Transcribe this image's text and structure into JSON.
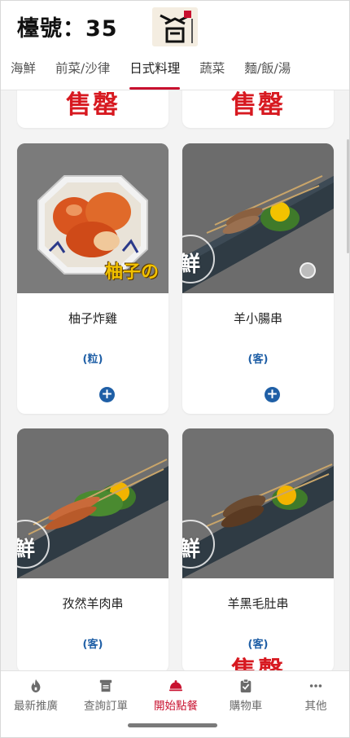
{
  "header": {
    "table_label": "檯號：35",
    "logo_icon": "restaurant-logo"
  },
  "tabs": [
    {
      "label": "海鮮",
      "active": false
    },
    {
      "label": "前菜/沙律",
      "active": false
    },
    {
      "label": "日式料理",
      "active": true
    },
    {
      "label": "蔬菜",
      "active": false
    },
    {
      "label": "麵/飯/湯",
      "active": false
    }
  ],
  "sold_out_label": "售罄",
  "items": [
    {
      "name": "柚子炸雞",
      "unit": "(粒)",
      "image_caption": "柚子の"
    },
    {
      "name": "羊小腸串",
      "unit": "(客)"
    },
    {
      "name": "孜然羊肉串",
      "unit": "(客)"
    },
    {
      "name": "羊黑毛肚串",
      "unit": "(客)",
      "sold_out": true
    }
  ],
  "watermark_text": "鮮",
  "bottom_nav": [
    {
      "label": "最新推廣",
      "icon": "fire-icon",
      "active": false
    },
    {
      "label": "查詢訂單",
      "icon": "receipt-icon",
      "active": false
    },
    {
      "label": "開始點餐",
      "icon": "cloche-icon",
      "active": true
    },
    {
      "label": "購物車",
      "icon": "clipboard-icon",
      "active": false
    },
    {
      "label": "其他",
      "icon": "more-icon",
      "active": false
    }
  ],
  "colors": {
    "accent": "#c8102e",
    "sold_out": "#d71920",
    "unit_blue": "#1f5fa6"
  }
}
